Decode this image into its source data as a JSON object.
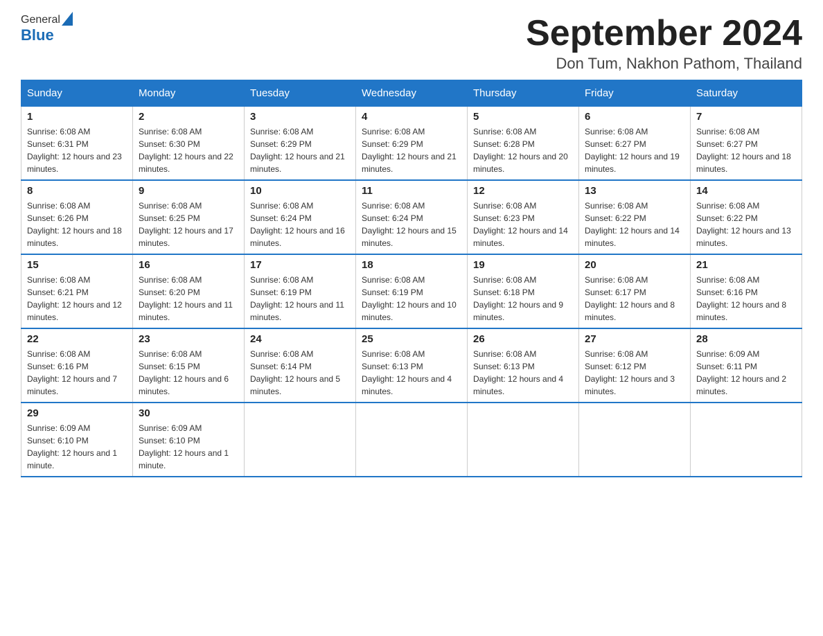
{
  "header": {
    "logo_general": "General",
    "logo_blue": "Blue",
    "month_title": "September 2024",
    "location": "Don Tum, Nakhon Pathom, Thailand"
  },
  "calendar": {
    "days_of_week": [
      "Sunday",
      "Monday",
      "Tuesday",
      "Wednesday",
      "Thursday",
      "Friday",
      "Saturday"
    ],
    "weeks": [
      [
        {
          "day": "1",
          "sunrise": "Sunrise: 6:08 AM",
          "sunset": "Sunset: 6:31 PM",
          "daylight": "Daylight: 12 hours and 23 minutes."
        },
        {
          "day": "2",
          "sunrise": "Sunrise: 6:08 AM",
          "sunset": "Sunset: 6:30 PM",
          "daylight": "Daylight: 12 hours and 22 minutes."
        },
        {
          "day": "3",
          "sunrise": "Sunrise: 6:08 AM",
          "sunset": "Sunset: 6:29 PM",
          "daylight": "Daylight: 12 hours and 21 minutes."
        },
        {
          "day": "4",
          "sunrise": "Sunrise: 6:08 AM",
          "sunset": "Sunset: 6:29 PM",
          "daylight": "Daylight: 12 hours and 21 minutes."
        },
        {
          "day": "5",
          "sunrise": "Sunrise: 6:08 AM",
          "sunset": "Sunset: 6:28 PM",
          "daylight": "Daylight: 12 hours and 20 minutes."
        },
        {
          "day": "6",
          "sunrise": "Sunrise: 6:08 AM",
          "sunset": "Sunset: 6:27 PM",
          "daylight": "Daylight: 12 hours and 19 minutes."
        },
        {
          "day": "7",
          "sunrise": "Sunrise: 6:08 AM",
          "sunset": "Sunset: 6:27 PM",
          "daylight": "Daylight: 12 hours and 18 minutes."
        }
      ],
      [
        {
          "day": "8",
          "sunrise": "Sunrise: 6:08 AM",
          "sunset": "Sunset: 6:26 PM",
          "daylight": "Daylight: 12 hours and 18 minutes."
        },
        {
          "day": "9",
          "sunrise": "Sunrise: 6:08 AM",
          "sunset": "Sunset: 6:25 PM",
          "daylight": "Daylight: 12 hours and 17 minutes."
        },
        {
          "day": "10",
          "sunrise": "Sunrise: 6:08 AM",
          "sunset": "Sunset: 6:24 PM",
          "daylight": "Daylight: 12 hours and 16 minutes."
        },
        {
          "day": "11",
          "sunrise": "Sunrise: 6:08 AM",
          "sunset": "Sunset: 6:24 PM",
          "daylight": "Daylight: 12 hours and 15 minutes."
        },
        {
          "day": "12",
          "sunrise": "Sunrise: 6:08 AM",
          "sunset": "Sunset: 6:23 PM",
          "daylight": "Daylight: 12 hours and 14 minutes."
        },
        {
          "day": "13",
          "sunrise": "Sunrise: 6:08 AM",
          "sunset": "Sunset: 6:22 PM",
          "daylight": "Daylight: 12 hours and 14 minutes."
        },
        {
          "day": "14",
          "sunrise": "Sunrise: 6:08 AM",
          "sunset": "Sunset: 6:22 PM",
          "daylight": "Daylight: 12 hours and 13 minutes."
        }
      ],
      [
        {
          "day": "15",
          "sunrise": "Sunrise: 6:08 AM",
          "sunset": "Sunset: 6:21 PM",
          "daylight": "Daylight: 12 hours and 12 minutes."
        },
        {
          "day": "16",
          "sunrise": "Sunrise: 6:08 AM",
          "sunset": "Sunset: 6:20 PM",
          "daylight": "Daylight: 12 hours and 11 minutes."
        },
        {
          "day": "17",
          "sunrise": "Sunrise: 6:08 AM",
          "sunset": "Sunset: 6:19 PM",
          "daylight": "Daylight: 12 hours and 11 minutes."
        },
        {
          "day": "18",
          "sunrise": "Sunrise: 6:08 AM",
          "sunset": "Sunset: 6:19 PM",
          "daylight": "Daylight: 12 hours and 10 minutes."
        },
        {
          "day": "19",
          "sunrise": "Sunrise: 6:08 AM",
          "sunset": "Sunset: 6:18 PM",
          "daylight": "Daylight: 12 hours and 9 minutes."
        },
        {
          "day": "20",
          "sunrise": "Sunrise: 6:08 AM",
          "sunset": "Sunset: 6:17 PM",
          "daylight": "Daylight: 12 hours and 8 minutes."
        },
        {
          "day": "21",
          "sunrise": "Sunrise: 6:08 AM",
          "sunset": "Sunset: 6:16 PM",
          "daylight": "Daylight: 12 hours and 8 minutes."
        }
      ],
      [
        {
          "day": "22",
          "sunrise": "Sunrise: 6:08 AM",
          "sunset": "Sunset: 6:16 PM",
          "daylight": "Daylight: 12 hours and 7 minutes."
        },
        {
          "day": "23",
          "sunrise": "Sunrise: 6:08 AM",
          "sunset": "Sunset: 6:15 PM",
          "daylight": "Daylight: 12 hours and 6 minutes."
        },
        {
          "day": "24",
          "sunrise": "Sunrise: 6:08 AM",
          "sunset": "Sunset: 6:14 PM",
          "daylight": "Daylight: 12 hours and 5 minutes."
        },
        {
          "day": "25",
          "sunrise": "Sunrise: 6:08 AM",
          "sunset": "Sunset: 6:13 PM",
          "daylight": "Daylight: 12 hours and 4 minutes."
        },
        {
          "day": "26",
          "sunrise": "Sunrise: 6:08 AM",
          "sunset": "Sunset: 6:13 PM",
          "daylight": "Daylight: 12 hours and 4 minutes."
        },
        {
          "day": "27",
          "sunrise": "Sunrise: 6:08 AM",
          "sunset": "Sunset: 6:12 PM",
          "daylight": "Daylight: 12 hours and 3 minutes."
        },
        {
          "day": "28",
          "sunrise": "Sunrise: 6:09 AM",
          "sunset": "Sunset: 6:11 PM",
          "daylight": "Daylight: 12 hours and 2 minutes."
        }
      ],
      [
        {
          "day": "29",
          "sunrise": "Sunrise: 6:09 AM",
          "sunset": "Sunset: 6:10 PM",
          "daylight": "Daylight: 12 hours and 1 minute."
        },
        {
          "day": "30",
          "sunrise": "Sunrise: 6:09 AM",
          "sunset": "Sunset: 6:10 PM",
          "daylight": "Daylight: 12 hours and 1 minute."
        },
        null,
        null,
        null,
        null,
        null
      ]
    ]
  }
}
